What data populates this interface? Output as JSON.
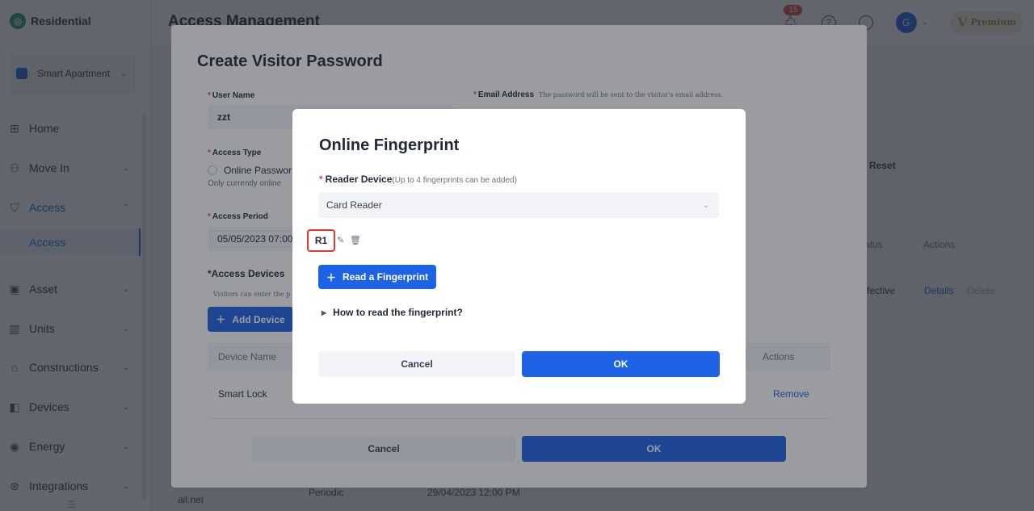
{
  "sidebar": {
    "brand": "Residential",
    "project": "Smart Apartment",
    "items": [
      {
        "label": "Home"
      },
      {
        "label": "Move In"
      },
      {
        "label": "Access"
      },
      {
        "label": "Asset"
      },
      {
        "label": "Units"
      },
      {
        "label": "Constructions"
      },
      {
        "label": "Devices"
      },
      {
        "label": "Energy"
      },
      {
        "label": "Integrations"
      }
    ],
    "sub_item": "Access"
  },
  "header": {
    "title": "Access Management",
    "notifications": "15",
    "avatar_initial": "G",
    "premium": "Premium"
  },
  "background": {
    "reset": "Reset",
    "status_header": "atus",
    "actions_header": "Actions",
    "row_status": "ffective",
    "details": "Details",
    "delete": "Delete",
    "bottom_email": "ail.net",
    "bottom_type": "Periodic",
    "bottom_date": "29/04/2023 12:00 PM"
  },
  "outer_modal": {
    "title": "Create Visitor Password",
    "user_name_label": "User Name",
    "user_name_value": "zzt",
    "email_label": "Email Address",
    "email_hint": "The password will be sent to the visitor's email address.",
    "access_type_label": "Access Type",
    "access_type_option": "Online Passwor",
    "access_type_note": "Only currently online",
    "access_period_label": "Access Period",
    "access_period_value": "05/05/2023 07:00",
    "access_devices_label": "*Access Devices",
    "access_devices_note": "Visitors can enter the p",
    "add_device": "Add Device",
    "table_headers": {
      "device_name": "Device Name",
      "actions": "Actions"
    },
    "row": {
      "device": "Smart Lock",
      "action": "Remove"
    },
    "cancel": "Cancel",
    "ok": "OK"
  },
  "inner_modal": {
    "title": "Online Fingerprint",
    "reader_label": "Reader Device",
    "reader_hint": "(Up to 4 fingerprints can be added)",
    "reader_value": "Card Reader",
    "fingerprint_tag": "R1",
    "read_button": "Read a Fingerprint",
    "how_to": "How to read the fingerprint?",
    "cancel": "Cancel",
    "ok": "OK"
  }
}
